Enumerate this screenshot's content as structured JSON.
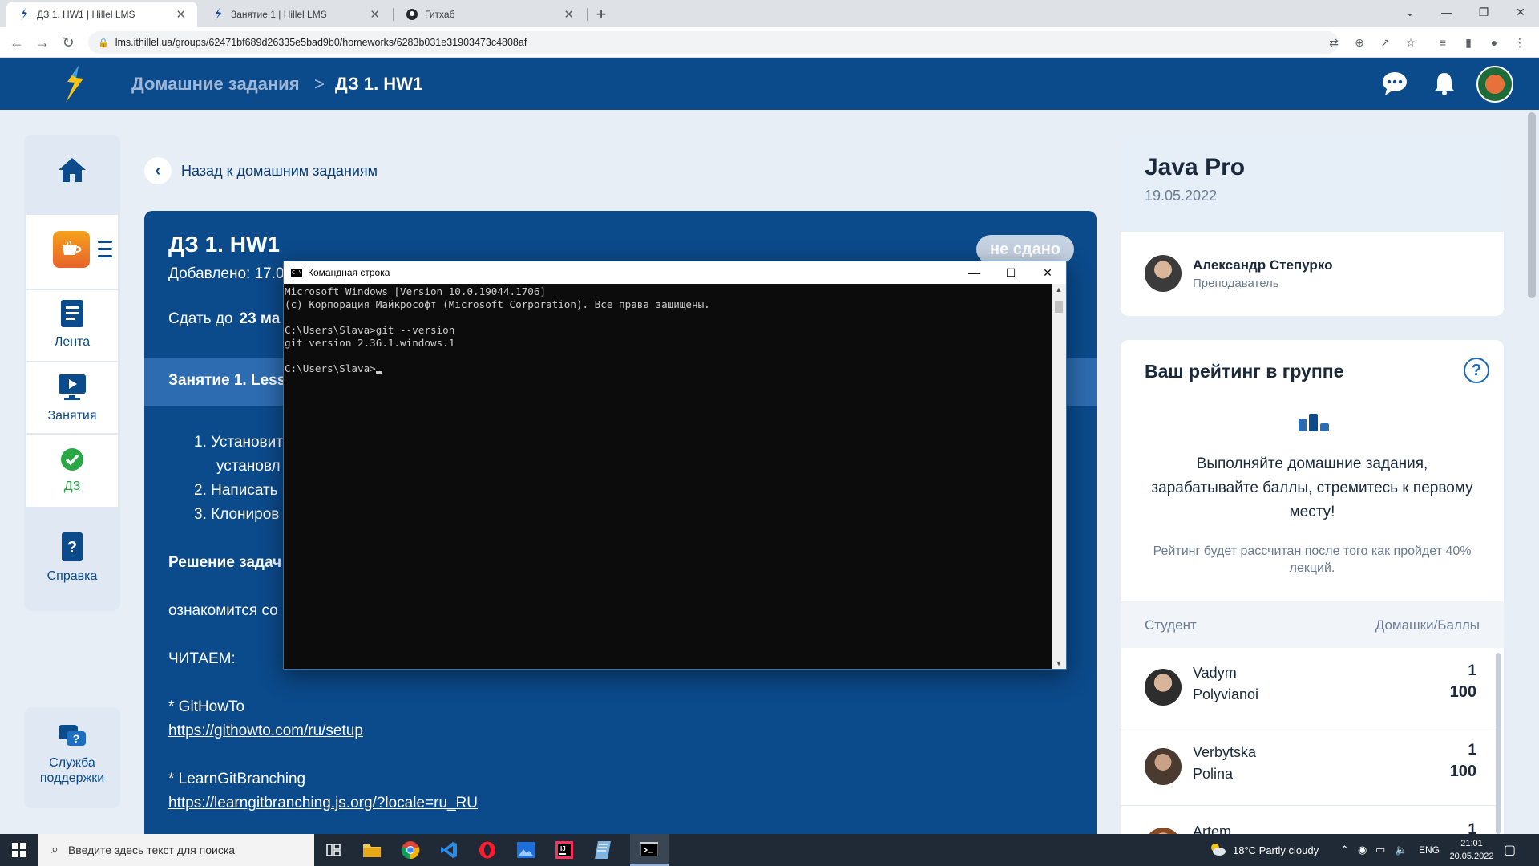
{
  "browser": {
    "tabs": [
      {
        "title": "ДЗ 1. HW1 | Hillel LMS",
        "icon": "hillel-logo-icon",
        "active": true
      },
      {
        "title": "Занятие 1 | Hillel LMS",
        "icon": "hillel-logo-icon",
        "active": false
      },
      {
        "title": "Гитхаб",
        "icon": "github-icon",
        "active": false
      }
    ],
    "url": "lms.ithillel.ua/groups/62471bf689d26335e5bad9b0/homeworks/6283b031e31903473c4808af"
  },
  "header": {
    "crumb_root": "Домашние задания",
    "crumb_separator": ">",
    "crumb_current": "ДЗ 1. HW1",
    "brand_colors": {
      "primary": "#0b4a8b",
      "accent": "#f5c518"
    }
  },
  "sidebar": {
    "items": [
      {
        "label": "Лента",
        "icon": "feed-icon"
      },
      {
        "label": "Занятия",
        "icon": "lessons-icon"
      },
      {
        "label": "ДЗ",
        "icon": "homework-check-icon"
      },
      {
        "label": "Справка",
        "icon": "help-book-icon"
      }
    ],
    "support_label": "Служба поддержки"
  },
  "main": {
    "back_label": "Назад к домашним заданиям",
    "title": "ДЗ 1. HW1",
    "added": "Добавлено: 17.0",
    "deadline_label": "Сдать до",
    "deadline_value": "23 ма",
    "status": "не сдано",
    "lesson": "Занятие 1. Lessc",
    "tasks": [
      "1.  Установит",
      "установл",
      "2.  Написать",
      "3.  Клониров"
    ],
    "solution_heading": "Решение задач",
    "intro": "ознакомится со",
    "read_label": "ЧИТАЕМ:",
    "links": [
      {
        "name": "* GitHowTo",
        "url": "https://githowto.com/ru/setup"
      },
      {
        "name": "* LearnGitBranching",
        "url": "https://learngitbranching.js.org/?locale=ru_RU"
      }
    ]
  },
  "cmd": {
    "title": "Командная строка",
    "lines": [
      "Microsoft Windows [Version 10.0.19044.1706]",
      "(c) Корпорация Майкрософт (Microsoft Corporation). Все права защищены.",
      "",
      "C:\\Users\\Slava>git --version",
      "git version 2.36.1.windows.1",
      "",
      "C:\\Users\\Slava>"
    ]
  },
  "course": {
    "name": "Java Pro",
    "date": "19.05.2022",
    "teacher_name": "Александр Степурко",
    "teacher_role": "Преподаватель"
  },
  "rating": {
    "title": "Ваш рейтинг в группе",
    "text": "Выполняйте домашние задания, зарабатывайте баллы, стремитесь к первому месту!",
    "note": "Рейтинг будет рассчитан после того как пройдет 40% лекций.",
    "col_student": "Студент",
    "col_points": "Домашки/Баллы",
    "students": [
      {
        "first": "Vadym",
        "last": "Polyvianoi",
        "homeworks": "1",
        "points": "100"
      },
      {
        "first": "Verbytska",
        "last": "Polina",
        "homeworks": "1",
        "points": "100"
      },
      {
        "first": "Artem",
        "last": "",
        "homeworks": "1",
        "points": ""
      }
    ]
  },
  "taskbar": {
    "search_placeholder": "Введите здесь текст для поиска",
    "weather": "18°C  Partly cloudy",
    "lang": "ENG",
    "time": "21:01",
    "date": "20.05.2022"
  }
}
